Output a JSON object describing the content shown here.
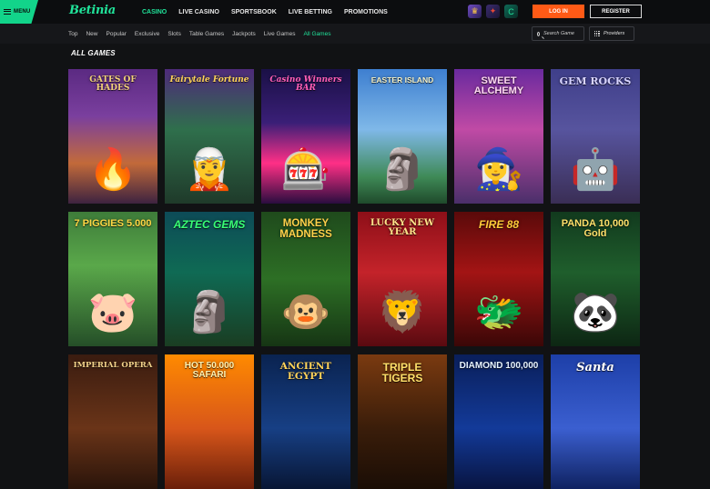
{
  "header": {
    "menu_label": "MENU",
    "logo": "Betinia",
    "nav": [
      "CASINO",
      "LIVE CASINO",
      "SPORTSBOOK",
      "LIVE BETTING",
      "PROMOTIONS"
    ],
    "active_nav": "CASINO",
    "promo_icons": [
      "crown-icon",
      "gift-icon",
      "c-coin-icon"
    ],
    "login_label": "LOG IN",
    "register_label": "REGISTER"
  },
  "filters": {
    "items": [
      "Top",
      "New",
      "Popular",
      "Exclusive",
      "Slots",
      "Table Games",
      "Jackpots",
      "Live Games",
      "All Games"
    ],
    "active": "All Games",
    "search_placeholder": "Search Game",
    "providers_label": "Providers"
  },
  "section": {
    "title": "ALL GAMES"
  },
  "games": [
    {
      "title": "GATES OF HADES",
      "art": "🔥"
    },
    {
      "title": "Fairytale Fortune",
      "art": "🧝"
    },
    {
      "title": "Casino Winners BAR",
      "art": "🎰"
    },
    {
      "title": "EASTER ISLAND",
      "art": "🗿"
    },
    {
      "title": "SWEET ALCHEMY",
      "art": "🧙‍♀️"
    },
    {
      "title": "GEM ROCKS",
      "art": "🤖"
    },
    {
      "title": "7 PIGGIES 5.000",
      "art": "🐷"
    },
    {
      "title": "AZTEC GEMS",
      "art": "🗿"
    },
    {
      "title": "MONKEY MADNESS",
      "art": "🐵"
    },
    {
      "title": "LUCKY NEW YEAR",
      "art": "🦁"
    },
    {
      "title": "FIRE 88",
      "art": "🐲"
    },
    {
      "title": "PANDA 10,000 Gold",
      "art": "🐼"
    },
    {
      "title": "IMPERIAL OPERA",
      "art": ""
    },
    {
      "title": "HOT 50.000 SAFARI",
      "art": ""
    },
    {
      "title": "ANCIENT EGYPT",
      "art": ""
    },
    {
      "title": "TRIPLE TIGERS",
      "art": ""
    },
    {
      "title": "DIAMOND 100,000",
      "art": ""
    },
    {
      "title": "Santa",
      "art": ""
    }
  ],
  "colors": {
    "accent": "#20e39a",
    "login": "#ff5a16",
    "background": "#111214"
  }
}
